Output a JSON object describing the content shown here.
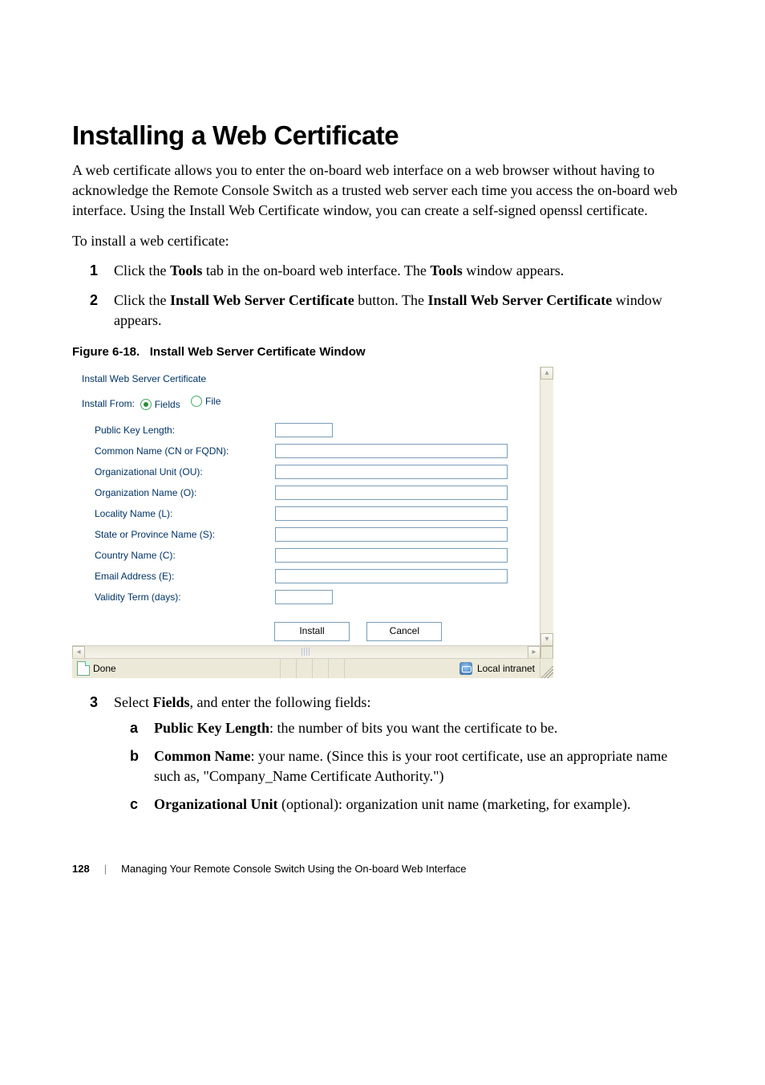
{
  "heading": "Installing a Web Certificate",
  "intro": "A web certificate allows you to enter the on-board web interface on a web browser without having to acknowledge the Remote Console Switch as a trusted web server each time you access the on-board web interface. Using the Install Web Certificate window, you can create a self-signed openssl certificate.",
  "to_install": "To install a web certificate:",
  "steps": {
    "s1_pre": "Click the ",
    "s1_bold1": "Tools",
    "s1_mid": " tab in the on-board web interface. The ",
    "s1_bold2": "Tools",
    "s1_post": " window appears.",
    "s2_pre": "Click the ",
    "s2_bold1": "Install Web Server Certificate",
    "s2_mid": " button. The ",
    "s2_bold2": "Install Web Server Certificate",
    "s2_post": " window appears.",
    "s3_pre": "Select ",
    "s3_bold": "Fields",
    "s3_post": ", and enter the following fields:"
  },
  "alpha": {
    "a_bold": "Public Key Length",
    "a_post": ": the number of bits you want the certificate to be.",
    "b_bold": "Common Name",
    "b_post": ": your name. (Since this is your root certificate, use an appropriate name such as, \"Company_Name Certificate Authority.\")",
    "c_bold": "Organizational Unit",
    "c_post": " (optional): organization unit name (marketing, for example)."
  },
  "markers": {
    "m1": "1",
    "m2": "2",
    "m3": "3",
    "ma": "a",
    "mb": "b",
    "mc": "c"
  },
  "figure_caption_pre": "Figure 6-18.",
  "figure_caption_title": "Install Web Server Certificate Window",
  "cert": {
    "title": "Install Web Server Certificate",
    "install_from_label": "Install From:",
    "opt_fields": "Fields",
    "opt_file": "File",
    "labels": {
      "pkl": "Public Key Length:",
      "cn": "Common Name (CN or FQDN):",
      "ou": "Organizational Unit (OU):",
      "o": "Organization Name (O):",
      "l": "Locality Name (L):",
      "s": "State or Province Name (S):",
      "c": "Country Name (C):",
      "e": "Email Address (E):",
      "vt": "Validity Term (days):"
    },
    "buttons": {
      "install": "Install",
      "cancel": "Cancel"
    },
    "status_done": "Done",
    "status_zone": "Local intranet"
  },
  "footer": {
    "page": "128",
    "title": "Managing Your Remote Console Switch Using the On-board Web Interface"
  }
}
